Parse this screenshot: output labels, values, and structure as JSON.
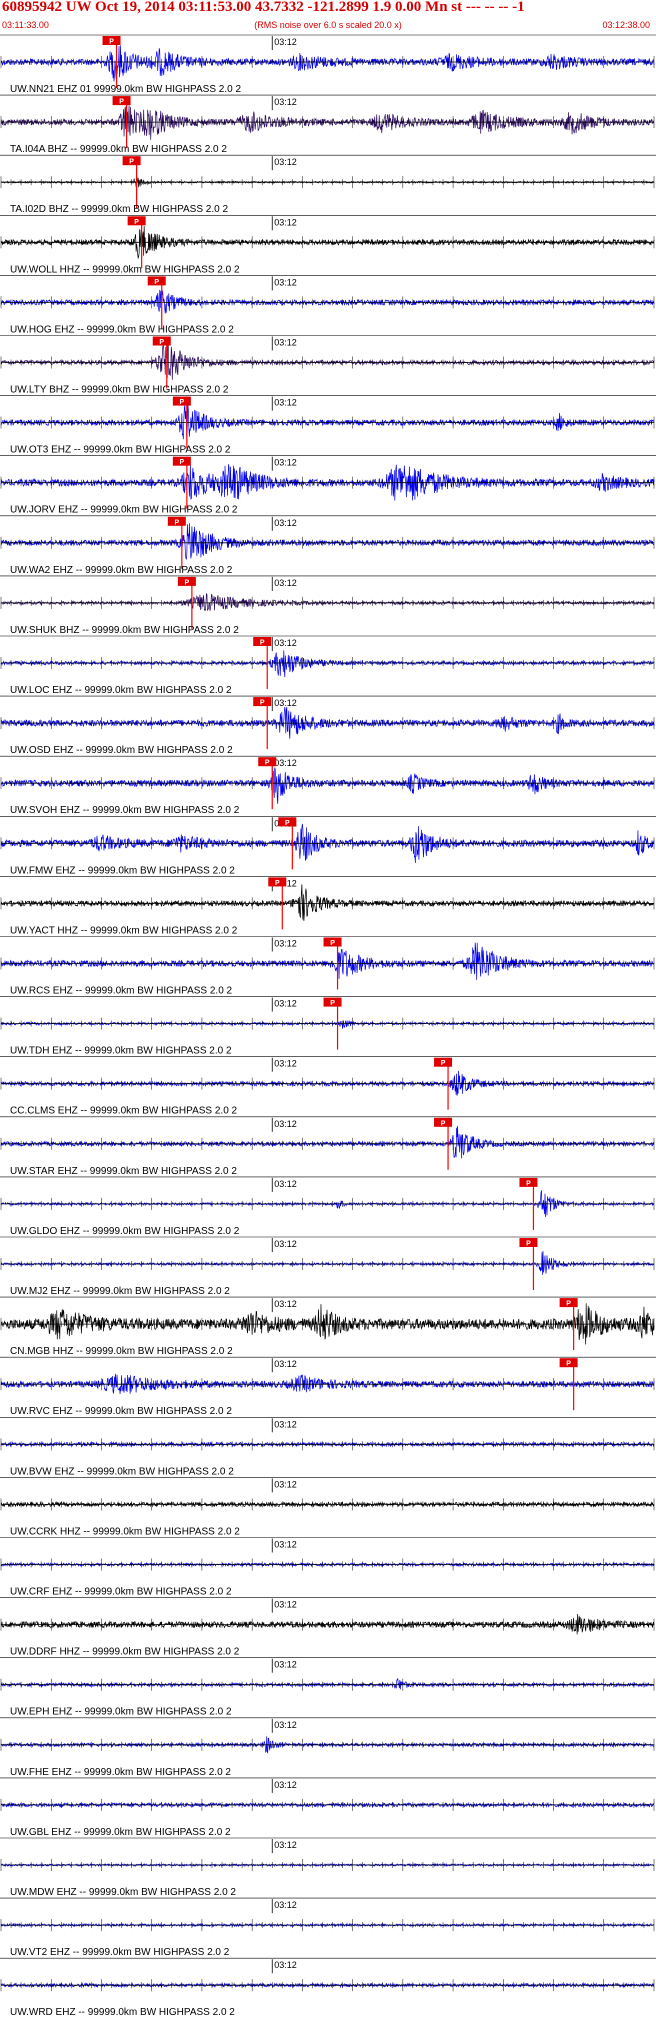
{
  "header": {
    "title": "60895942 UW Oct 19, 2014 03:11:53.00   43.7332 -121.2899  1.9 0.00 Mn st --- -- --  -1",
    "start_time": "03:11:33.00",
    "subtitle": "(RMS noise over 6.0 s scaled 20.0 x)",
    "end_time": "03:12:38.00"
  },
  "colors": {
    "header_text": "#d40000",
    "pick_box": "#e00000",
    "pick_line": "#ff0000",
    "blue_trace": "#0000ee",
    "black_trace": "#000000",
    "purple_trace": "#2a0a5e",
    "axis": "#000000"
  },
  "chart_data": {
    "type": "seismogram",
    "x_unit": "seconds from 03:11:33.00",
    "xlim": [
      0,
      65
    ],
    "minute_tick_label": "03:12",
    "minute_tick_at": 27,
    "pick_label": "P",
    "traces": [
      {
        "label": "UW.NN21 EHZ 01 99999.0km BW  HIGHPASS  2.0  2",
        "color": "blue",
        "pick": 11.5,
        "amp": 0.15,
        "events": [
          [
            11.5,
            0.9,
            2.5
          ],
          [
            16,
            0.5,
            3
          ],
          [
            30,
            0.3,
            4
          ],
          [
            45,
            0.3,
            4
          ],
          [
            55,
            0.3,
            3
          ]
        ]
      },
      {
        "label": "TA.I04A BHZ -- 99999.0km BW  HIGHPASS  2.0  2",
        "color": "purple",
        "pick": 12.5,
        "amp": 0.14,
        "events": [
          [
            12.5,
            0.9,
            2
          ],
          [
            15,
            0.6,
            3
          ],
          [
            25,
            0.4,
            4
          ],
          [
            38,
            0.4,
            3
          ],
          [
            48,
            0.45,
            4
          ],
          [
            57,
            0.45,
            3
          ]
        ]
      },
      {
        "label": "TA.I02D BHZ -- 99999.0km BW  HIGHPASS  2.0  2",
        "color": "black",
        "pick": 13.5,
        "amp": 0.04,
        "events": [
          [
            13.5,
            0.3,
            1
          ]
        ]
      },
      {
        "label": "UW.WOLL HHZ -- 99999.0km BW  HIGHPASS  2.0  2",
        "color": "black",
        "pick": 14.0,
        "amp": 0.12,
        "events": [
          [
            14,
            0.8,
            2.5
          ]
        ]
      },
      {
        "label": "UW.HOG EHZ -- 99999.0km BW  HIGHPASS  2.0  2",
        "color": "blue",
        "pick": 16.0,
        "amp": 0.12,
        "events": [
          [
            16,
            0.6,
            2
          ]
        ]
      },
      {
        "label": "UW.LTY BHZ -- 99999.0km BW  HIGHPASS  2.0  2",
        "color": "purple",
        "pick": 16.5,
        "amp": 0.1,
        "events": [
          [
            16.5,
            1.0,
            3
          ]
        ]
      },
      {
        "label": "UW.OT3 EHZ -- 99999.0km BW  HIGHPASS  2.0  2",
        "color": "blue",
        "pick": 18.5,
        "amp": 0.13,
        "events": [
          [
            18.5,
            0.9,
            2.5
          ],
          [
            55.5,
            0.4,
            1
          ]
        ]
      },
      {
        "label": "UW.JORV EHZ -- 99999.0km BW  HIGHPASS  2.0  2",
        "color": "blue",
        "pick": 18.5,
        "amp": 0.16,
        "events": [
          [
            19,
            0.8,
            3
          ],
          [
            23,
            0.8,
            4
          ],
          [
            40,
            1.0,
            5
          ],
          [
            60,
            0.3,
            3
          ]
        ]
      },
      {
        "label": "UW.WA2 EHZ -- 99999.0km BW  HIGHPASS  2.0  2",
        "color": "blue",
        "pick": 18.0,
        "amp": 0.13,
        "events": [
          [
            19,
            1.0,
            3
          ]
        ]
      },
      {
        "label": "UW.SHUK BHZ -- 99999.0km BW  HIGHPASS  2.0  2",
        "color": "purple",
        "pick": 19.0,
        "amp": 0.07,
        "events": [
          [
            20.5,
            0.4,
            6
          ]
        ]
      },
      {
        "label": "UW.LOC EHZ -- 99999.0km BW  HIGHPASS  2.0  2",
        "color": "blue",
        "pick": 26.5,
        "amp": 0.08,
        "events": [
          [
            28,
            0.7,
            3
          ]
        ]
      },
      {
        "label": "UW.OSD EHZ -- 99999.0km BW  HIGHPASS  2.0  2",
        "color": "blue",
        "pick": 26.5,
        "amp": 0.15,
        "events": [
          [
            28.5,
            0.7,
            3
          ],
          [
            50,
            0.3,
            2
          ],
          [
            55.5,
            0.4,
            1
          ]
        ]
      },
      {
        "label": "UW.SVOH EHZ -- 99999.0km BW  HIGHPASS  2.0  2",
        "color": "blue",
        "pick": 27.0,
        "amp": 0.15,
        "events": [
          [
            27.5,
            0.9,
            2
          ],
          [
            41,
            0.4,
            1.5
          ],
          [
            53,
            0.5,
            1.5
          ]
        ]
      },
      {
        "label": "UW.FMW EHZ -- 99999.0km BW  HIGHPASS  2.0  2",
        "color": "blue",
        "pick": 29.0,
        "amp": 0.16,
        "events": [
          [
            30,
            0.9,
            2
          ],
          [
            41.5,
            1.0,
            2
          ],
          [
            63.5,
            0.6,
            1
          ],
          [
            10,
            0.3,
            3
          ],
          [
            18,
            0.3,
            3
          ]
        ]
      },
      {
        "label": "UW.YACT HHZ -- 99999.0km BW  HIGHPASS  2.0  2",
        "color": "black",
        "pick": 28.0,
        "amp": 0.12,
        "events": [
          [
            30,
            0.8,
            2.5
          ]
        ]
      },
      {
        "label": "UW.RCS EHZ -- 99999.0km BW  HIGHPASS  2.0  2",
        "color": "blue",
        "pick": 33.5,
        "amp": 0.14,
        "events": [
          [
            34,
            0.7,
            3
          ],
          [
            47.5,
            1.0,
            3
          ]
        ]
      },
      {
        "label": "UW.TDH EHZ -- 99999.0km BW  HIGHPASS  2.0  2",
        "color": "blue",
        "pick": 33.5,
        "amp": 0.06,
        "events": [
          [
            34,
            0.3,
            1
          ]
        ]
      },
      {
        "label": "CC.CLMS EHZ -- 99999.0km BW  HIGHPASS  2.0  2",
        "color": "blue",
        "pick": 44.5,
        "amp": 0.1,
        "events": [
          [
            45.5,
            0.6,
            2
          ]
        ]
      },
      {
        "label": "UW.STAR EHZ -- 99999.0km BW  HIGHPASS  2.0  2",
        "color": "blue",
        "pick": 44.5,
        "amp": 0.1,
        "events": [
          [
            45.5,
            0.9,
            2
          ]
        ]
      },
      {
        "label": "UW.GLDO EHZ -- 99999.0km BW  HIGHPASS  2.0  2",
        "color": "blue",
        "pick": 53.0,
        "amp": 0.06,
        "events": [
          [
            33.5,
            0.4,
            0.5
          ],
          [
            54,
            0.8,
            1.5
          ]
        ]
      },
      {
        "label": "UW.MJ2 EHZ -- 99999.0km BW  HIGHPASS  2.0  2",
        "color": "blue",
        "pick": 53.0,
        "amp": 0.06,
        "events": [
          [
            54,
            0.6,
            1.5
          ]
        ]
      },
      {
        "label": "CN.MGB HHZ -- 99999.0km BW  HIGHPASS  2.0  2",
        "color": "black",
        "pick": 57.0,
        "amp": 0.25,
        "events": [
          [
            6,
            0.6,
            4
          ],
          [
            25,
            0.5,
            3
          ],
          [
            32,
            0.8,
            2
          ],
          [
            58,
            0.9,
            2.5
          ],
          [
            64,
            0.6,
            2
          ]
        ]
      },
      {
        "label": "UW.RVC EHZ -- 99999.0km BW  HIGHPASS  2.0  2",
        "color": "blue",
        "pick": 57.0,
        "amp": 0.14,
        "events": [
          [
            12,
            0.4,
            6
          ],
          [
            30,
            0.3,
            4
          ]
        ]
      },
      {
        "label": "UW.BVW EHZ -- 99999.0km BW  HIGHPASS  2.0  2",
        "color": "blue",
        "pick": null,
        "amp": 0.09,
        "events": []
      },
      {
        "label": "UW.CCRK HHZ -- 99999.0km BW  HIGHPASS  2.0  2",
        "color": "black",
        "pick": null,
        "amp": 0.1,
        "events": []
      },
      {
        "label": "UW.CRF EHZ -- 99999.0km BW  HIGHPASS  2.0  2",
        "color": "blue",
        "pick": null,
        "amp": 0.07,
        "events": []
      },
      {
        "label": "UW.DDRF HHZ -- 99999.0km BW  HIGHPASS  2.0  2",
        "color": "black",
        "pick": null,
        "amp": 0.14,
        "events": [
          [
            57.5,
            0.4,
            3
          ]
        ]
      },
      {
        "label": "UW.EPH EHZ -- 99999.0km BW  HIGHPASS  2.0  2",
        "color": "blue",
        "pick": null,
        "amp": 0.08,
        "events": [
          [
            39.5,
            0.3,
            1
          ]
        ]
      },
      {
        "label": "UW.FHE EHZ -- 99999.0km BW  HIGHPASS  2.0  2",
        "color": "blue",
        "pick": null,
        "amp": 0.08,
        "events": [
          [
            26.5,
            0.4,
            1
          ]
        ]
      },
      {
        "label": "UW.GBL EHZ -- 99999.0km BW  HIGHPASS  2.0  2",
        "color": "blue",
        "pick": null,
        "amp": 0.09,
        "events": []
      },
      {
        "label": "UW.MDW EHZ -- 99999.0km BW  HIGHPASS  2.0  2",
        "color": "blue",
        "pick": null,
        "amp": 0.05,
        "events": []
      },
      {
        "label": "UW.VT2 EHZ -- 99999.0km BW  HIGHPASS  2.0  2",
        "color": "blue",
        "pick": null,
        "amp": 0.06,
        "events": []
      },
      {
        "label": "UW.WRD EHZ -- 99999.0km BW  HIGHPASS  2.0  2",
        "color": "blue",
        "pick": null,
        "amp": 0.08,
        "events": []
      }
    ]
  }
}
